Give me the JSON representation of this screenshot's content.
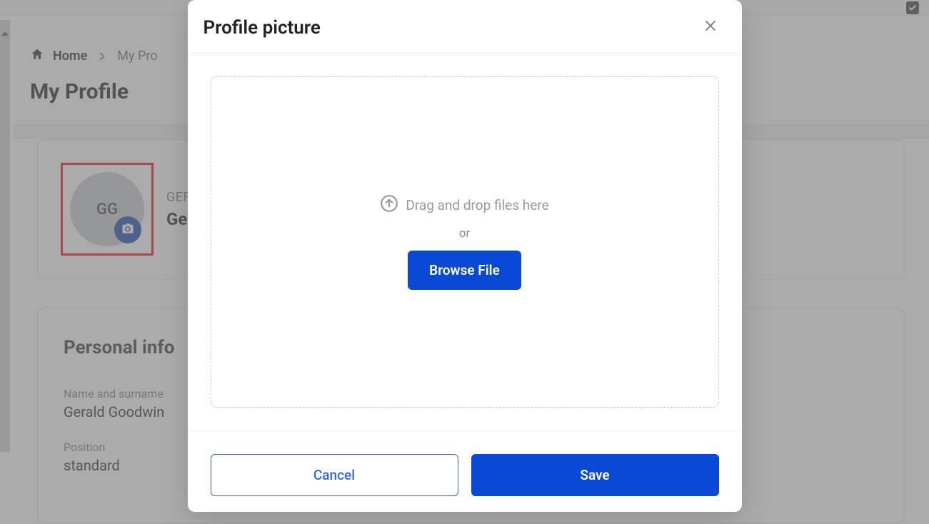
{
  "breadcrumb": {
    "home_label": "Home",
    "current_label": "My Pro"
  },
  "page": {
    "title": "My Profile"
  },
  "profile": {
    "avatar_initials": "GG",
    "sub_label": "GEF",
    "display_name": "Ge"
  },
  "personal_info": {
    "section_title": "Personal info",
    "fields": {
      "name_label": "Name and surname",
      "name_value": "Gerald Goodwin",
      "position_label": "Position",
      "position_value": "standard"
    }
  },
  "modal": {
    "title": "Profile picture",
    "drop_text": "Drag and drop files here",
    "or_text": "or",
    "browse_label": "Browse File",
    "cancel_label": "Cancel",
    "save_label": "Save"
  }
}
